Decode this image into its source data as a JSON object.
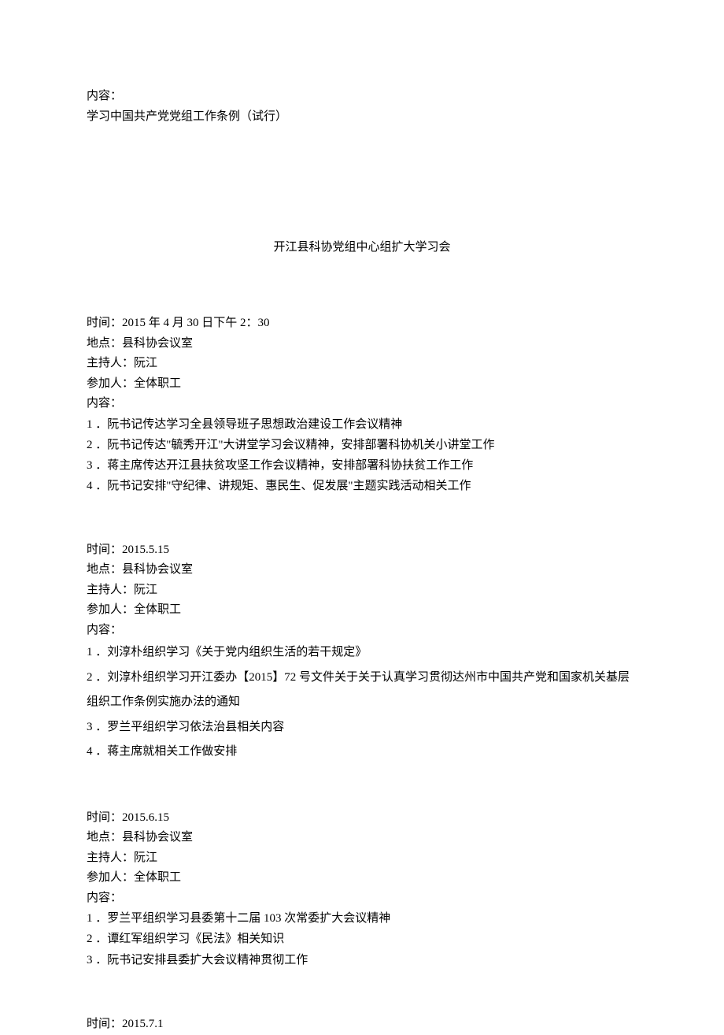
{
  "intro": {
    "label": "内容：",
    "text": "学习中国共产党党组工作条例（试行）"
  },
  "title": "开江县科协党组中心组扩大学习会",
  "meetings": [
    {
      "time_label": "时间：",
      "time": "2015 年 4 月 30 日下午 2：30",
      "location_label": "地点：",
      "location": "县科协会议室",
      "host_label": "主持人：",
      "host": "阮江",
      "attendees_label": "参加人：",
      "attendees": "全体职工",
      "content_label": "内容：",
      "items": [
        "1 ．阮书记传达学习全县领导班子思想政治建设工作会议精神",
        "2 ．阮书记传达\"毓秀开江\"大讲堂学习会议精神，安排部署科协机关小讲堂工作",
        "3 ．蒋主席传达开江县扶贫攻坚工作会议精神，安排部署科协扶贫工作工作",
        "4 ．阮书记安排\"守纪律、讲规矩、惠民生、促发展\"主题实践活动相关工作"
      ]
    },
    {
      "time_label": "时间：",
      "time": "2015.5.15",
      "location_label": "地点：",
      "location": "县科协会议室",
      "host_label": "主持人：",
      "host": "阮江",
      "attendees_label": "参加人：",
      "attendees": "全体职工",
      "content_label": "内容：",
      "items": [
        "1 ．刘淳朴组织学习《关于党内组织生活的若干规定》",
        "2 ．刘淳朴组织学习开江委办【2015】72 号文件关于关于认真学习贯彻达州市中国共产党和国家机关基层组织工作条例实施办法的通知",
        "3 ．罗兰平组织学习依法治县相关内容",
        "4 ．蒋主席就相关工作做安排"
      ]
    },
    {
      "time_label": "时间：",
      "time": "2015.6.15",
      "location_label": "地点：",
      "location": "县科协会议室",
      "host_label": "主持人：",
      "host": "阮江",
      "attendees_label": "参加人：",
      "attendees": "全体职工",
      "content_label": "内容：",
      "items": [
        "1 ．罗兰平组织学习县委第十二届 103 次常委扩大会议精神",
        "2 ．谭红军组织学习《民法》相关知识",
        "3 ．阮书记安排县委扩大会议精神贯彻工作"
      ]
    }
  ],
  "final": {
    "time_label": "时间：",
    "time": "2015.7.1"
  }
}
